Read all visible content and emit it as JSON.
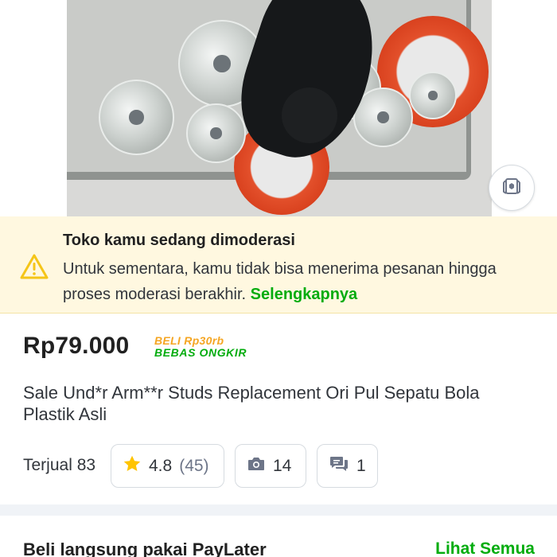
{
  "moderation_banner": {
    "title": "Toko kamu sedang dimoderasi",
    "message": "Untuk sementara, kamu tidak bisa menerima pesanan hingga proses moderasi berakhir.",
    "link_label": "Selengkapnya",
    "icon": "warning-triangle-icon",
    "accent_color": "#f5c518",
    "background_color": "#fff8e0"
  },
  "product": {
    "price": "Rp79.000",
    "promo": {
      "line1": "BELI Rp30rb",
      "line2": "BEBAS ONGKIR"
    },
    "title": "Sale Und*r Arm**r Studs Replacement Ori Pul Sepatu Bola Plastik Asli",
    "sold": "Terjual 83",
    "rating": "4.8",
    "rating_count": "(45)",
    "photo_count": "14",
    "discussion_count": "1"
  },
  "image_overlay": {
    "ar_icon": "try-on-icon"
  },
  "paylater": {
    "title": "Beli langsung pakai PayLater",
    "see_all_label": "Lihat Semua"
  },
  "colors": {
    "brand_green": "#03ac0e",
    "star_yellow": "#ffc400",
    "promo_orange": "#f5a623"
  }
}
